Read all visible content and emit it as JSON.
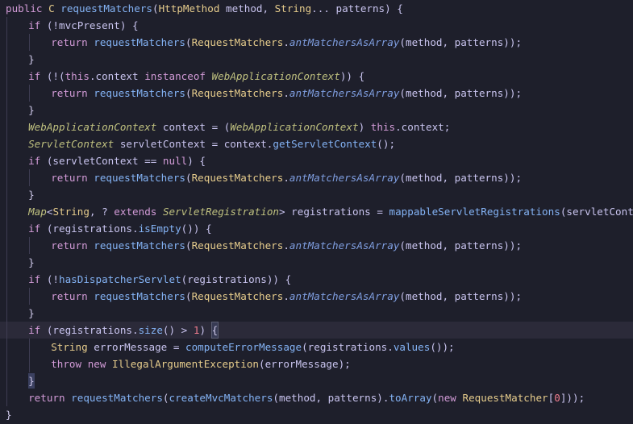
{
  "theme": {
    "background": "#1e1f2b",
    "current_line": "#2b2a39",
    "keyword": "#d29bd7",
    "method": "#84b3f5",
    "type": "#e6cc8c",
    "interface_type": "#bfc07f",
    "static_call": "#7f9ee0",
    "identifier": "#c9c4ef",
    "number": "#f07d8e",
    "punctuation": "#cfc9ea",
    "string_param": "#e6cc8c"
  },
  "editor": {
    "language": "java",
    "current_line_index": 19,
    "lines": [
      {
        "indent": 0,
        "tokens": [
          [
            "public ",
            "kw"
          ],
          [
            "C ",
            "ty"
          ],
          [
            "requestMatchers",
            "fn"
          ],
          [
            "(",
            "p"
          ],
          [
            "HttpMethod",
            "ty"
          ],
          [
            " method, ",
            "id"
          ],
          [
            "String",
            "ty"
          ],
          [
            "... patterns) {",
            "id"
          ]
        ]
      },
      {
        "indent": 1,
        "tokens": [
          [
            "if ",
            "kw"
          ],
          [
            "(!mvcPresent) {",
            "id"
          ]
        ]
      },
      {
        "indent": 2,
        "tokens": [
          [
            "return ",
            "kw"
          ],
          [
            "requestMatchers",
            "fn"
          ],
          [
            "(",
            "p"
          ],
          [
            "RequestMatchers",
            "ty"
          ],
          [
            ".",
            "p"
          ],
          [
            "antMatchersAsArray",
            "sf"
          ],
          [
            "(method, patterns));",
            "id"
          ]
        ]
      },
      {
        "indent": 1,
        "tokens": [
          [
            "}",
            "p"
          ]
        ]
      },
      {
        "indent": 1,
        "tokens": [
          [
            "if ",
            "kw"
          ],
          [
            "(!(",
            "id"
          ],
          [
            "this",
            "kw"
          ],
          [
            ".context ",
            "id"
          ],
          [
            "instanceof ",
            "kw"
          ],
          [
            "WebApplicationContext",
            "it"
          ],
          [
            ")) {",
            "id"
          ]
        ]
      },
      {
        "indent": 2,
        "tokens": [
          [
            "return ",
            "kw"
          ],
          [
            "requestMatchers",
            "fn"
          ],
          [
            "(",
            "p"
          ],
          [
            "RequestMatchers",
            "ty"
          ],
          [
            ".",
            "p"
          ],
          [
            "antMatchersAsArray",
            "sf"
          ],
          [
            "(method, patterns));",
            "id"
          ]
        ]
      },
      {
        "indent": 1,
        "tokens": [
          [
            "}",
            "p"
          ]
        ]
      },
      {
        "indent": 1,
        "tokens": [
          [
            "WebApplicationContext",
            "it"
          ],
          [
            " context = (",
            "id"
          ],
          [
            "WebApplicationContext",
            "it"
          ],
          [
            ") ",
            "id"
          ],
          [
            "this",
            "kw"
          ],
          [
            ".context;",
            "id"
          ]
        ]
      },
      {
        "indent": 1,
        "tokens": [
          [
            "ServletContext",
            "it"
          ],
          [
            " servletContext = context.",
            "id"
          ],
          [
            "getServletContext",
            "fn"
          ],
          [
            "();",
            "id"
          ]
        ]
      },
      {
        "indent": 1,
        "tokens": [
          [
            "if ",
            "kw"
          ],
          [
            "(servletContext == ",
            "id"
          ],
          [
            "null",
            "kw"
          ],
          [
            ") {",
            "id"
          ]
        ]
      },
      {
        "indent": 2,
        "tokens": [
          [
            "return ",
            "kw"
          ],
          [
            "requestMatchers",
            "fn"
          ],
          [
            "(",
            "p"
          ],
          [
            "RequestMatchers",
            "ty"
          ],
          [
            ".",
            "p"
          ],
          [
            "antMatchersAsArray",
            "sf"
          ],
          [
            "(method, patterns));",
            "id"
          ]
        ]
      },
      {
        "indent": 1,
        "tokens": [
          [
            "}",
            "p"
          ]
        ]
      },
      {
        "indent": 1,
        "tokens": [
          [
            "Map",
            "it"
          ],
          [
            "<",
            "id"
          ],
          [
            "String",
            "ty"
          ],
          [
            ", ? ",
            "id"
          ],
          [
            "extends ",
            "kw"
          ],
          [
            "ServletRegistration",
            "it"
          ],
          [
            "> registrations = ",
            "id"
          ],
          [
            "mappableServletRegistrations",
            "fn"
          ],
          [
            "(servletContext);",
            "id"
          ]
        ]
      },
      {
        "indent": 1,
        "tokens": [
          [
            "if ",
            "kw"
          ],
          [
            "(registrations.",
            "id"
          ],
          [
            "isEmpty",
            "fn"
          ],
          [
            "()) {",
            "id"
          ]
        ]
      },
      {
        "indent": 2,
        "tokens": [
          [
            "return ",
            "kw"
          ],
          [
            "requestMatchers",
            "fn"
          ],
          [
            "(",
            "p"
          ],
          [
            "RequestMatchers",
            "ty"
          ],
          [
            ".",
            "p"
          ],
          [
            "antMatchersAsArray",
            "sf"
          ],
          [
            "(method, patterns));",
            "id"
          ]
        ]
      },
      {
        "indent": 1,
        "tokens": [
          [
            "}",
            "p"
          ]
        ]
      },
      {
        "indent": 1,
        "tokens": [
          [
            "if ",
            "kw"
          ],
          [
            "(!",
            "id"
          ],
          [
            "hasDispatcherServlet",
            "fn"
          ],
          [
            "(registrations)) {",
            "id"
          ]
        ]
      },
      {
        "indent": 2,
        "tokens": [
          [
            "return ",
            "kw"
          ],
          [
            "requestMatchers",
            "fn"
          ],
          [
            "(",
            "p"
          ],
          [
            "RequestMatchers",
            "ty"
          ],
          [
            ".",
            "p"
          ],
          [
            "antMatchersAsArray",
            "sf"
          ],
          [
            "(method, patterns));",
            "id"
          ]
        ]
      },
      {
        "indent": 1,
        "tokens": [
          [
            "}",
            "p"
          ]
        ]
      },
      {
        "indent": 1,
        "tokens": [
          [
            "if ",
            "kw"
          ],
          [
            "(registrations.",
            "id"
          ],
          [
            "size",
            "fn"
          ],
          [
            "() > ",
            "id"
          ],
          [
            "1",
            "num"
          ],
          [
            ") ",
            "id"
          ],
          [
            "{",
            "box"
          ]
        ]
      },
      {
        "indent": 2,
        "tokens": [
          [
            "String",
            "ty"
          ],
          [
            " errorMessage = ",
            "id"
          ],
          [
            "computeErrorMessage",
            "fn"
          ],
          [
            "(registrations.",
            "id"
          ],
          [
            "values",
            "fn"
          ],
          [
            "());",
            "id"
          ]
        ]
      },
      {
        "indent": 2,
        "tokens": [
          [
            "throw ",
            "kw"
          ],
          [
            "new ",
            "kw"
          ],
          [
            "IllegalArgumentException",
            "ty"
          ],
          [
            "(errorMessage);",
            "id"
          ]
        ]
      },
      {
        "indent": 1,
        "tokens": [
          [
            "}",
            "boxc"
          ]
        ]
      },
      {
        "indent": 1,
        "tokens": [
          [
            "return ",
            "kw"
          ],
          [
            "requestMatchers",
            "fn"
          ],
          [
            "(",
            "p"
          ],
          [
            "createMvcMatchers",
            "fn"
          ],
          [
            "(method, patterns).",
            "id"
          ],
          [
            "toArray",
            "fn"
          ],
          [
            "(",
            "id"
          ],
          [
            "new ",
            "kw"
          ],
          [
            "RequestMatcher",
            "ty"
          ],
          [
            "[",
            "id"
          ],
          [
            "0",
            "num"
          ],
          [
            "]));",
            "id"
          ]
        ]
      },
      {
        "indent": 0,
        "tokens": [
          [
            "}",
            "p"
          ]
        ]
      }
    ]
  }
}
